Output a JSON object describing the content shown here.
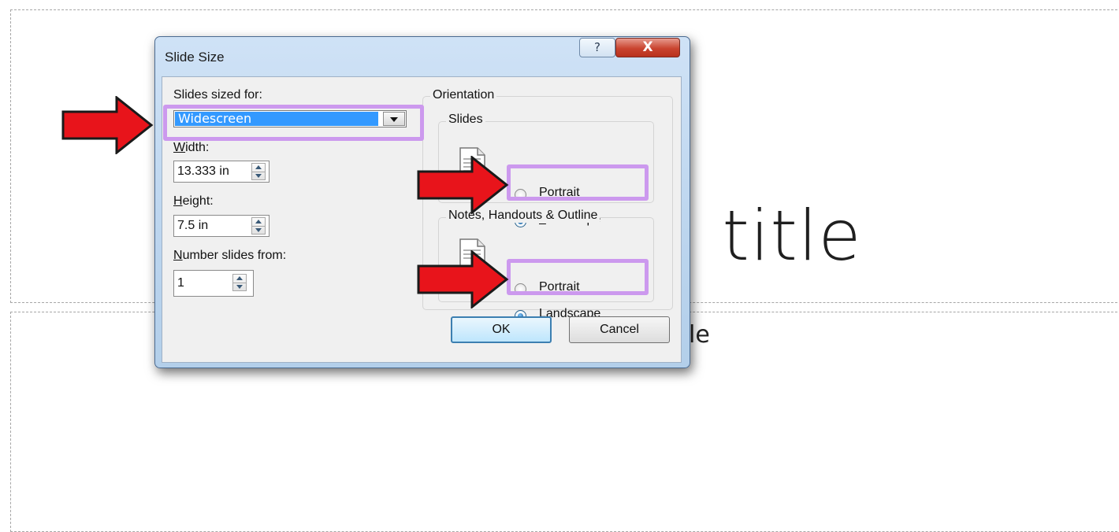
{
  "slide": {
    "title_visible": "l title",
    "subtitle_visible": "le"
  },
  "dialog": {
    "title": "Slide Size",
    "help_label": "?",
    "close_label": "X",
    "slides_sized_for": {
      "label": "Slides sized for:",
      "value": "Widescreen"
    },
    "width": {
      "label_u": "W",
      "label_rest": "idth:",
      "value": "13.333 in"
    },
    "height": {
      "label_u": "H",
      "label_rest": "eight:",
      "value": "7.5 in"
    },
    "number_from": {
      "label_u": "N",
      "label_rest": "umber slides from:",
      "value": "1"
    },
    "orientation": {
      "title": "Orientation",
      "slides": {
        "title": "Slides",
        "portrait_u": "P",
        "portrait_rest": "ortrait",
        "landscape_u": "L",
        "landscape_rest": "andscape",
        "selected": "Landscape"
      },
      "notes": {
        "title": "Notes, Handouts & Outline",
        "portrait_u": "P",
        "portrait_rest": "ortrait",
        "landscape_u": "L",
        "landscape_rest": "andscape",
        "selected": "Landscape"
      }
    },
    "ok_label": "OK",
    "cancel_label": "Cancel"
  },
  "colors": {
    "highlight": "#cc99ee",
    "arrow": "#e8141b",
    "selection": "#3399ff"
  }
}
